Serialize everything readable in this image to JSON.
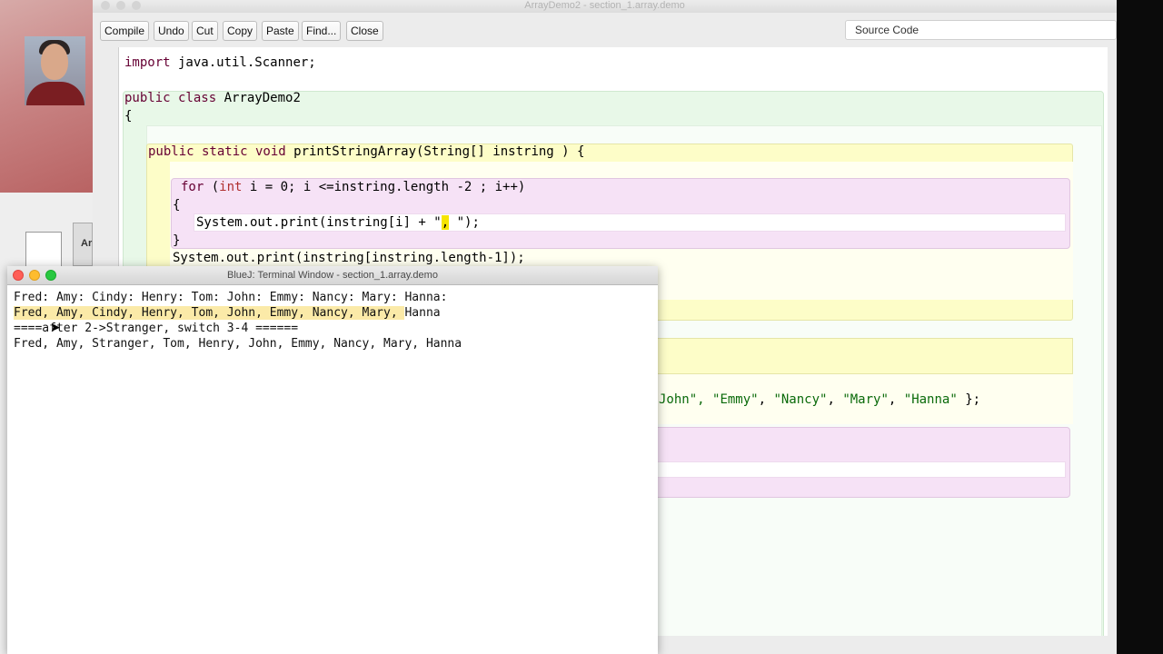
{
  "editor": {
    "title": "ArrayDemo2 - section_1.array.demo",
    "toolbar": [
      "Compile",
      "Undo",
      "Cut",
      "Copy",
      "Paste",
      "Find...",
      "Close"
    ],
    "view_select": "Source Code"
  },
  "desktop": {
    "thumb_label": "Ar"
  },
  "code": {
    "l1_kw": "import",
    "l1_rest": " java.util.Scanner;",
    "l2_kw": "public class",
    "l2_rest": " ArrayDemo2",
    "l3": "{",
    "l4_kw": "public static void",
    "l4_rest": " printStringArray(String[] instring ) {",
    "l5_kw": "for",
    "l5_a": " (",
    "l5_ty": "int",
    "l5_rest": " i = 0; i <=instring.length -2 ; i++)",
    "l6": "{",
    "l7_pre": "System.out.print(instring[i] + \"",
    "l7_hl": ",",
    "l7_post": " \");",
    "l8": "}",
    "l9": "System.out.print(instring[instring.length-1]);",
    "l10_partial": "John\", ",
    "l10_s1": "\"Emmy\"",
    "l10_c1": ", ",
    "l10_s2": "\"Nancy\"",
    "l10_c2": ", ",
    "l10_s3": "\"Mary\"",
    "l10_c3": ", ",
    "l10_s4": "\"Hanna\"",
    "l10_end": " };"
  },
  "terminal": {
    "title": "BlueJ: Terminal Window - section_1.array.demo",
    "line1": "Fred: Amy: Cindy: Henry: Tom: John: Emmy: Nancy: Mary: Hanna:",
    "line2_sel": "Fred, Amy, Cindy, Henry, Tom, John, Emmy, Nancy, Mary, ",
    "line2_rest": "Hanna",
    "line3": "====after 2->Stranger, switch 3-4 ======",
    "line4": "Fred, Amy, Stranger, Tom, Henry, John, Emmy, Nancy, Mary, Hanna"
  }
}
